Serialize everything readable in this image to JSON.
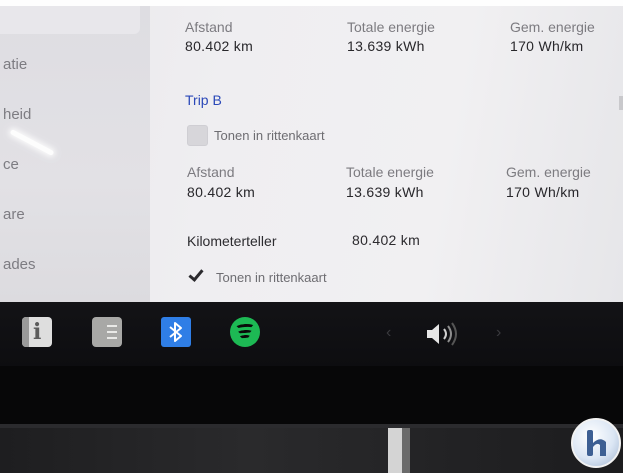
{
  "sidebar": {
    "items": [
      {
        "label": "atie"
      },
      {
        "label": "heid"
      },
      {
        "label": "ce"
      },
      {
        "label": "are"
      },
      {
        "label": "ades"
      }
    ]
  },
  "trip_a": {
    "stats": [
      {
        "label": "Afstand",
        "value": "80.402 km"
      },
      {
        "label": "Totale energie",
        "value": "13.639 kWh"
      },
      {
        "label": "Gem. energie",
        "value": "170 Wh/km"
      }
    ]
  },
  "trip_b": {
    "title": "Trip B",
    "show_in_map_label": "Tonen in rittenkaart",
    "show_in_map_checked": false,
    "stats": [
      {
        "label": "Afstand",
        "value": "80.402 km"
      },
      {
        "label": "Totale energie",
        "value": "13.639 kWh"
      },
      {
        "label": "Gem. energie",
        "value": "170 Wh/km"
      }
    ]
  },
  "odometer": {
    "label": "Kilometerteller",
    "value": "80.402 km",
    "show_in_map_label": "Tonen in rittenkaart",
    "show_in_map_checked": true
  },
  "dock": {
    "apps": [
      {
        "icon": "owners-manual-icon"
      },
      {
        "icon": "notes-icon"
      },
      {
        "icon": "bluetooth-icon",
        "color": "#2f7ee6"
      },
      {
        "icon": "spotify-icon",
        "color": "#1db954"
      }
    ],
    "prev_glyph": "‹",
    "next_glyph": "›",
    "volume_icon": "volume-icon"
  },
  "colors": {
    "accent_blue": "#2a48b8",
    "screen_bg": "#efeef1"
  }
}
